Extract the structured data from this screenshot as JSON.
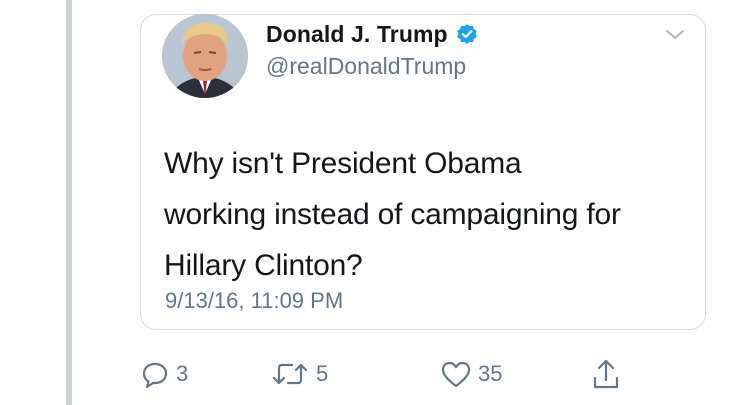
{
  "tweet": {
    "author_name": "Donald J. Trump",
    "author_handle": "@realDonaldTrump",
    "verified": true,
    "text_lines": [
      "Why isn't President Obama",
      "working instead of campaigning for",
      "Hillary Clinton?"
    ],
    "timestamp": "9/13/16, 11:09 PM"
  },
  "actions": {
    "reply_count": "3",
    "retweet_count": "5",
    "like_count": "35"
  },
  "icons": {
    "reply": "reply-icon",
    "retweet": "retweet-icon",
    "like": "heart-icon",
    "share": "share-icon",
    "caret": "chevron-down-icon",
    "verified": "verified-badge-icon"
  },
  "colors": {
    "text": "#14171a",
    "secondary": "#657786",
    "verified_blue": "#1da1f2",
    "border": "#d3dbe2",
    "thread_line": "#c9d2da"
  }
}
